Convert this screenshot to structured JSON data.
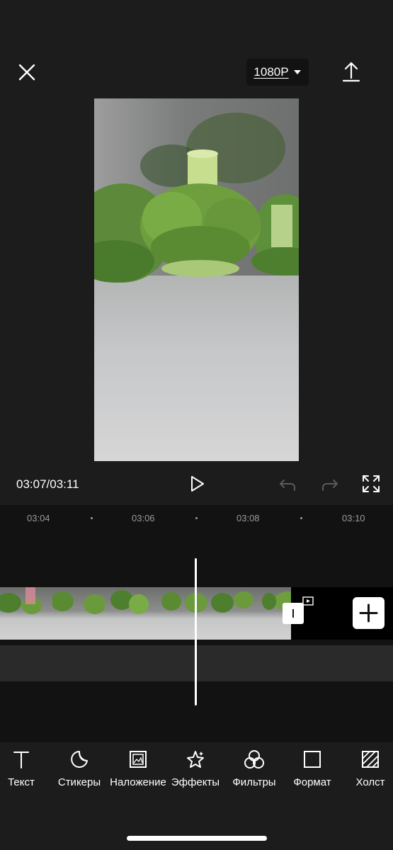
{
  "header": {
    "resolution_label": "1080P",
    "close_icon": "close-icon",
    "export_icon": "upload-icon"
  },
  "playback": {
    "timecode": "03:07/03:11",
    "icons": [
      "play-icon",
      "undo-icon",
      "redo-icon",
      "fullscreen-icon"
    ]
  },
  "timeline": {
    "ruler_labels": [
      "03:04",
      "03:06",
      "03:08",
      "03:10"
    ],
    "add_icon": "plus-icon"
  },
  "toolbar": {
    "items": [
      {
        "label": "Текст",
        "icon": "text-icon"
      },
      {
        "label": "Стикеры",
        "icon": "sticker-icon"
      },
      {
        "label": "Наложение",
        "icon": "overlay-icon"
      },
      {
        "label": "Эффекты",
        "icon": "effects-icon"
      },
      {
        "label": "Фильтры",
        "icon": "filters-icon"
      },
      {
        "label": "Формат",
        "icon": "format-icon"
      },
      {
        "label": "Холст",
        "icon": "canvas-icon"
      }
    ]
  },
  "colors": {
    "background": "#1c1c1c",
    "timeline_bg": "#121212",
    "accent": "#ffffff"
  }
}
